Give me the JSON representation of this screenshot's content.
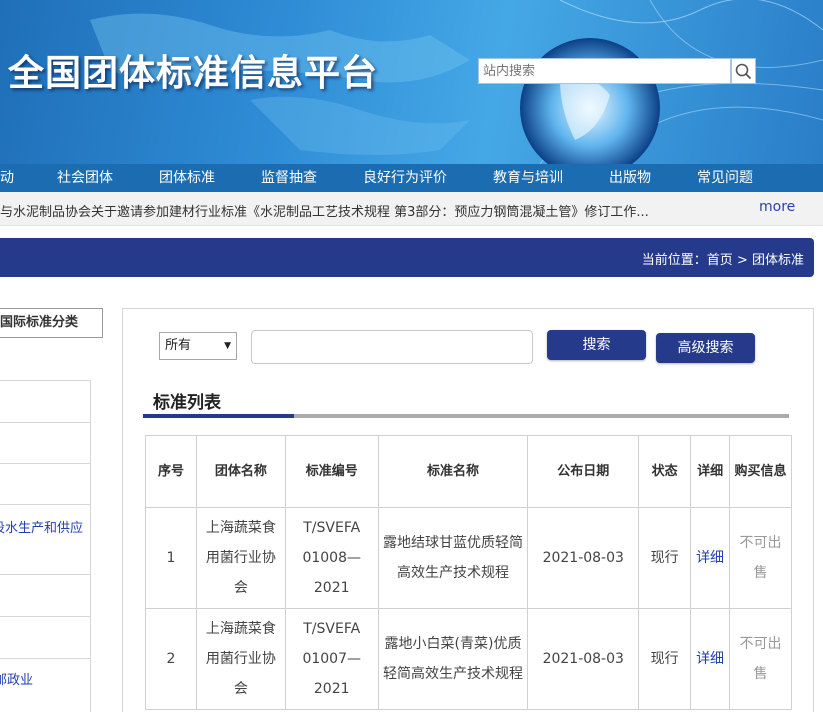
{
  "header": {
    "site_title": "全国团体标准信息平台",
    "search_placeholder": "站内搜索",
    "search_icon": "search-icon"
  },
  "nav": {
    "items": [
      "动",
      "社会团体",
      "团体标准",
      "监督抽查",
      "良好行为评价",
      "教育与培训",
      "出版物",
      "常见问题"
    ]
  },
  "ticker": {
    "text": "与水泥制品协会关于邀请参加建材行业标准《水泥制品工艺技术规程 第3部分：预应力钢筒混凝土管》修订工作...",
    "more": "more"
  },
  "breadcrumb": {
    "label": "当前位置：",
    "home": "首页",
    "sep": ">",
    "current": "团体标准"
  },
  "sidebar": {
    "tab": "国际标准分类",
    "links": [
      "设水生产和供应",
      "邮政业"
    ]
  },
  "search": {
    "scope_value": "所有",
    "keyword_value": "",
    "search_button": "搜索",
    "advanced_button": "高级搜索"
  },
  "list": {
    "title": "标准列表",
    "columns": [
      "序号",
      "团体名称",
      "标准编号",
      "标准名称",
      "公布日期",
      "状态",
      "详细",
      "购买信息"
    ],
    "rows": [
      {
        "no": "1",
        "org": "上海蔬菜食用菌行业协会",
        "code": "T/SVEFA 01008—2021",
        "name": "露地结球甘蓝优质轻简高效生产技术规程",
        "date": "2021-08-03",
        "status": "现行",
        "detail": "详细",
        "buy": "不可出售"
      },
      {
        "no": "2",
        "org": "上海蔬菜食用菌行业协会",
        "code": "T/SVEFA 01007—2021",
        "name": "露地小白菜(青菜)优质轻简高效生产技术规程",
        "date": "2021-08-03",
        "status": "现行",
        "detail": "详细",
        "buy": "不可出售"
      }
    ]
  },
  "colors": {
    "nav_bg": "#1b6cb0",
    "crumb_bg": "#253a8a",
    "button_bg": "#253a8a",
    "link": "#2440b0"
  }
}
